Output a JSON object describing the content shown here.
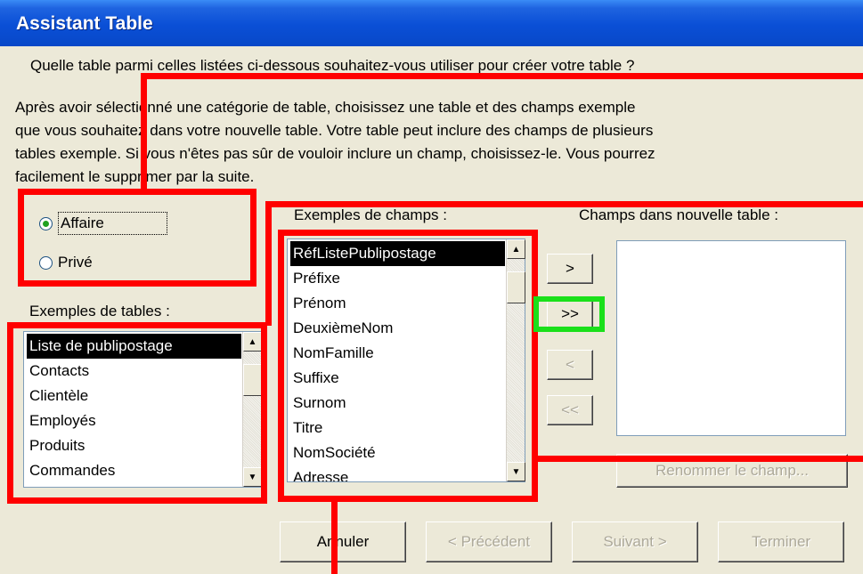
{
  "window": {
    "title": "Assistant Table"
  },
  "question": "Quelle table parmi celles listées ci-dessous souhaitez-vous utiliser pour créer votre table ?",
  "description": [
    "Après avoir sélectionné une catégorie de table, choisissez une table et des champs exemple",
    "que vous souhaitez dans votre nouvelle table. Votre table peut inclure des champs de plusieurs",
    "tables exemple. Si vous n'êtes pas sûr de vouloir inclure un champ, choisissez-le. Vous pourrez",
    "facilement le supprimer par la suite."
  ],
  "category": {
    "options": [
      {
        "label": "Affaire",
        "selected": true
      },
      {
        "label": "Privé",
        "selected": false
      }
    ]
  },
  "tables": {
    "label": "Exemples de tables :",
    "items": [
      "Liste de publipostage",
      "Contacts",
      "Clientèle",
      "Employés",
      "Produits",
      "Commandes"
    ],
    "selected_index": 0
  },
  "fields": {
    "label": "Exemples de champs :",
    "items": [
      "RéfListePublipostage",
      "Préfixe",
      "Prénom",
      "DeuxièmeNom",
      "NomFamille",
      "Suffixe",
      "Surnom",
      "Titre",
      "NomSociété",
      "Adresse"
    ],
    "selected_index": 0
  },
  "new_table": {
    "label": "Champs dans nouvelle table :",
    "items": []
  },
  "transfer_buttons": {
    "add_one": ">",
    "add_all": ">>",
    "remove_one": "<",
    "remove_all": "<<"
  },
  "rename_button": "Renommer le champ...",
  "footer": {
    "cancel": "Annuler",
    "previous": "< Précédent",
    "next": "Suivant >",
    "finish": "Terminer"
  },
  "colors": {
    "title_bar": "#0A4FD6",
    "dialog_bg": "#ECE9D8",
    "annotation_red": "#FF0000",
    "annotation_green": "#1AE01A"
  }
}
